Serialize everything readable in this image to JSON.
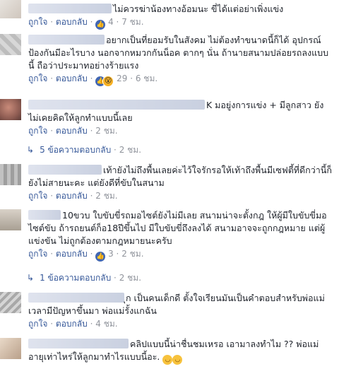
{
  "comments": [
    {
      "text": "ไม่ควรฆ่าน้องทางอ้อมนะ ขี่ได้แต่อย่าเพิ่งแข่ง",
      "like": "ถูกใจ",
      "reply": "ตอบกลับ",
      "reactions": "4",
      "time": "7 ชม."
    },
    {
      "text": "อยากเป็นที่ยอมรับในสังคม ไม่ต้องทำขนาดนี้ก็ได้ อุปกรณ์ป้องกันมีอะไรบาง นอกจากหมวกกันน็อค ตากๆ นั่น ถ้านายสนามปล่อยรถลงแบบนี้ ถือว่าประมาทอย่างร้ายแรง",
      "like": "ถูกใจ",
      "reply": "ตอบกลับ",
      "reactions": "29",
      "time": "6 ชม."
    },
    {
      "text": "K มอยู่งการแข่ง + มีลูกสาว ยังไม่เคยคิดให้ลูกทำแบบนี้เลย",
      "like": "ถูกใจ",
      "reply": "ตอบกลับ",
      "time": "2 ชม."
    },
    {
      "text": "เท้ายังไม่ถึงพื้นเลยค่ะไว้ใจรักรอให้เท้าถึงพื้นมีเซฟตี้ที่ดีกว่านี้ก็ยังไม่สายนะคะ แต่ยังดีที่ขับในสนาม",
      "like": "ถูกใจ",
      "reply": "ตอบกลับ",
      "time": "2 ชม."
    },
    {
      "text": "10ขวบ ใบขับขี่รถมอไซต์ยังไม่มีเลย สนามน่าจะตั้งกฎ ให้ผู้มีใบขับขี่มอไซต์ขับ ถ้ารถยนต์ก็อ18ปีขึ้นไป มีใบขับขี่ถึงลงได้ สนามอาจจะถูกกฎหมาย แต่ผู้แข่งขัน ไม่ถูกต้องตามกฎหมายนะครับ",
      "like": "ถูกใจ",
      "reply": "ตอบกลับ",
      "reactions": "3",
      "time": "2 ชม."
    },
    {
      "text": "ุก เป็นคนเด็กดี ตั้งใจเรียนมันเป็นคำตอบสำหรับพ่อแม่ เวลามีปัญหาขึ้นมา พ่อแม่รั้งแกฉัน",
      "like": "ถูกใจ",
      "reply": "ตอบกลับ",
      "time": "4 ชม."
    },
    {
      "text": "คลิปแบบนี้น่าชื่นชมเหรอ เอามาลงทำไม ?? พ่อแม่อายุเท่าไหร่ให้ลูกมาทำไรแบบนี้อะ.",
      "emoji": "😑😑"
    }
  ],
  "replies": [
    {
      "label": "5 ข้อความตอบกลับ",
      "time": "2 ชม."
    },
    {
      "label": "1 ข้อความตอบกลับ",
      "time": "2 ชม."
    }
  ],
  "separator": "·",
  "colors": {
    "link": "#365899",
    "meta": "#90949c",
    "text": "#1d2129",
    "like_badge": "#4267b2"
  }
}
